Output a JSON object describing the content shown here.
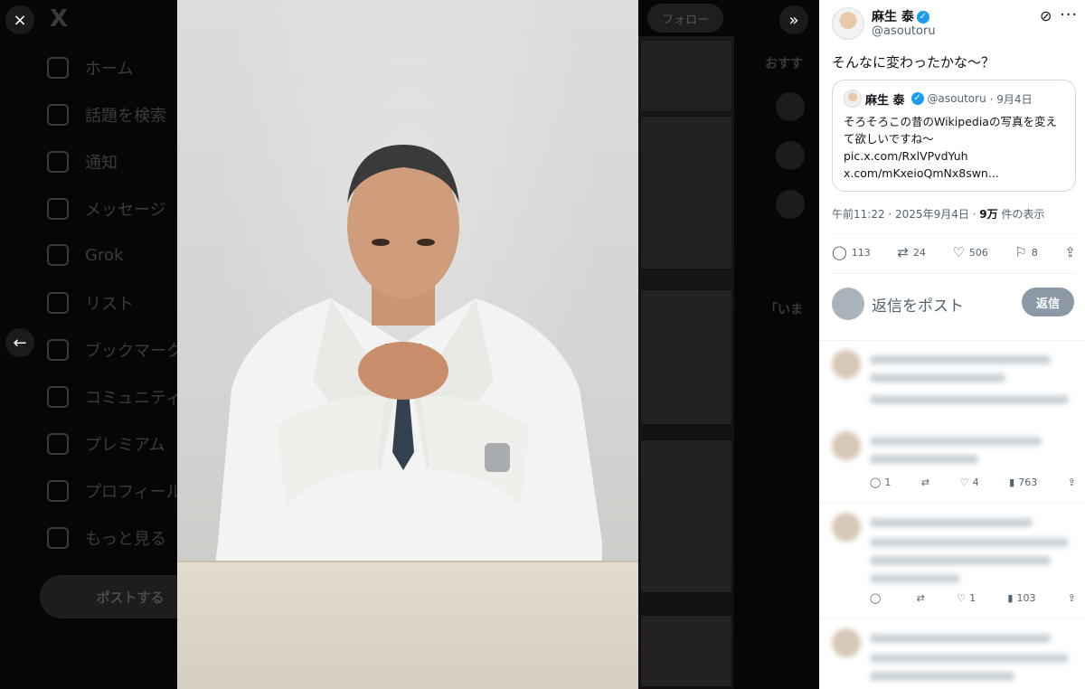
{
  "overlay": {
    "close_icon": "×",
    "back_icon": "←",
    "expand_icon": "»"
  },
  "background_app": {
    "logo": "X",
    "nav": [
      "ホーム",
      "話題を検索",
      "通知",
      "メッセージ",
      "Grok",
      "リスト",
      "ブックマーク",
      "コミュニティ",
      "プレミアム",
      "プロフィール",
      "もっと見る"
    ],
    "post_button": "ポストする",
    "follow_button": "フォロー",
    "side_heading": "おすす",
    "side_heading2": "「いま"
  },
  "tweet": {
    "author_name": "麻生 泰",
    "author_handle": "@asoutoru",
    "verified_mark": "✓",
    "grok_icon": "⊘",
    "more_icon": "···",
    "text": "そんなに変わったかな〜？",
    "quote": {
      "name": "麻生 泰",
      "handle": "@asoutoru",
      "date": "· 9月4日",
      "line1": "そろそろこの昔のWikipediaの写真を変え",
      "line2": "て欲しいですね〜",
      "line3": "pic.x.com/RxlVPvdYuh",
      "line4": "x.com/mKxeioQmNx8swn..."
    },
    "timestamp": "午前11:22 · 2025年9月4日 · ",
    "views_count": "9万",
    "views_label": " 件の表示",
    "actions": {
      "replies": "113",
      "reposts": "24",
      "likes": "506",
      "bookmarks": "8"
    },
    "reply_placeholder": "返信をポスト",
    "reply_button": "返信"
  },
  "replies": [
    {
      "replies": "1",
      "likes": "4",
      "views": "763"
    },
    {
      "replies": "",
      "likes": "1",
      "views": "103"
    }
  ]
}
